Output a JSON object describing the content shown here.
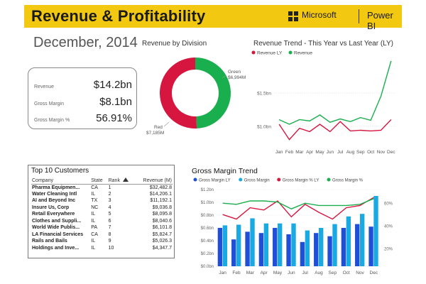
{
  "header": {
    "title": "Revenue & Profitability",
    "brand": "Microsoft",
    "product": "Power BI"
  },
  "date_title": "December, 2014",
  "kpis": [
    {
      "label": "Revenue",
      "value": "$14.2bn"
    },
    {
      "label": "Gross Margin",
      "value": "$8.1bn"
    },
    {
      "label": "Gross Margin %",
      "value": "56.91%"
    }
  ],
  "customers": {
    "title": "Top 10 Customers",
    "columns": {
      "company": "Company",
      "state": "State",
      "rank": "Rank",
      "sort_icon": "sort-ascending-icon",
      "revenue": "Revenue (M)"
    },
    "rows": [
      {
        "company": "Pharma Equipmen...",
        "state": "CA",
        "rank": "1",
        "revenue": "$32,482.8"
      },
      {
        "company": "Water Cleaning Intl",
        "state": "IL",
        "rank": "2",
        "revenue": "$14,206.1"
      },
      {
        "company": "AI and Beyond Inc",
        "state": "TX",
        "rank": "3",
        "revenue": "$11,192.1"
      },
      {
        "company": "Insure Us, Corp",
        "state": "NC",
        "rank": "4",
        "revenue": "$9,036.8"
      },
      {
        "company": "Retail Everywhere",
        "state": "IL",
        "rank": "5",
        "revenue": "$8,095.8"
      },
      {
        "company": "Clothes and Suppli...",
        "state": "IL",
        "rank": "6",
        "revenue": "$8,040.6"
      },
      {
        "company": "World Wide Publis...",
        "state": "PA",
        "rank": "7",
        "revenue": "$6,101.8"
      },
      {
        "company": "LA Financial Services",
        "state": "CA",
        "rank": "8",
        "revenue": "$5,824.7"
      },
      {
        "company": "Rails and Bails",
        "state": "IL",
        "rank": "9",
        "revenue": "$5,026.3"
      },
      {
        "company": "Holdings and Inve...",
        "state": "IL",
        "rank": "10",
        "revenue": "$4,347.7"
      }
    ]
  },
  "colors": {
    "header_bg": "#F2C811",
    "red": "#D7163F",
    "green": "#1AAF4E",
    "dark_blue": "#1F4FD8",
    "light_blue": "#19A9E3"
  },
  "chart_data": [
    {
      "type": "pie",
      "title": "Revenue by Division",
      "donut": true,
      "slices": [
        {
          "name": "Green",
          "label_value": "$6,994M",
          "value": 6994,
          "color": "#1AAF4E"
        },
        {
          "name": "Red",
          "label_value": "$7,185M",
          "value": 7185,
          "color": "#D7163F"
        }
      ]
    },
    {
      "type": "line",
      "title": "Revenue Trend - This Year vs Last Year (LY)",
      "categories": [
        "Jan",
        "Feb",
        "Mar",
        "Apr",
        "May",
        "Jun",
        "Jul",
        "Aug",
        "Sep",
        "Oct",
        "Nov",
        "Dec"
      ],
      "y_ticks": [
        {
          "value": 1.0,
          "label": "$1.0bn"
        },
        {
          "value": 1.5,
          "label": "$1.5bn"
        }
      ],
      "ylim": [
        0.7,
        2.0
      ],
      "legend": "top-left",
      "series": [
        {
          "name": "Revenue LY",
          "color": "#D7163F",
          "values": [
            1.03,
            0.8,
            0.97,
            0.92,
            1.03,
            0.92,
            1.07,
            0.93,
            0.94,
            0.93,
            0.94,
            1.1
          ]
        },
        {
          "name": "Revenue",
          "color": "#1AAF4E",
          "values": [
            1.1,
            1.03,
            1.1,
            1.08,
            1.17,
            1.06,
            1.11,
            1.07,
            1.13,
            1.09,
            1.45,
            1.98
          ]
        }
      ]
    },
    {
      "type": "bar",
      "title": "Gross Margin Trend",
      "categories": [
        "Jan",
        "Feb",
        "Mar",
        "Apr",
        "May",
        "Jun",
        "Jul",
        "Aug",
        "Sep",
        "Oct",
        "Nov",
        "Dec"
      ],
      "legend": "top-left",
      "left_axis": {
        "ticks": [
          "$0.0bn",
          "$0.2bn",
          "$0.4bn",
          "$0.6bn",
          "$0.8bn",
          "$1.0bn",
          "$1.2bn"
        ],
        "ylim": [
          0,
          1.2
        ]
      },
      "right_axis": {
        "ticks": [
          "20%",
          "40%",
          "60%"
        ],
        "ylim": [
          0.045,
          0.72
        ]
      },
      "series": [
        {
          "name": "Gross Margin LY",
          "kind": "bar",
          "axis": "left",
          "color": "#1F4FD8",
          "values": [
            0.6,
            0.42,
            0.54,
            0.52,
            0.6,
            0.5,
            0.38,
            0.52,
            0.47,
            0.6,
            0.66,
            0.62
          ]
        },
        {
          "name": "Gross Margin",
          "kind": "bar",
          "axis": "left",
          "color": "#19A9E3",
          "values": [
            0.64,
            0.65,
            0.75,
            0.67,
            0.67,
            0.67,
            0.56,
            0.6,
            0.66,
            0.78,
            0.82,
            1.1
          ]
        },
        {
          "name": "Gross Margin % LY",
          "kind": "line",
          "axis": "right",
          "color": "#D7163F",
          "values": [
            0.5,
            0.46,
            0.56,
            0.54,
            0.62,
            0.48,
            0.59,
            0.52,
            0.46,
            0.56,
            0.58,
            0.65
          ]
        },
        {
          "name": "Gross Margin %",
          "kind": "line",
          "axis": "right",
          "color": "#1AAF4E",
          "values": [
            0.6,
            0.59,
            0.62,
            0.62,
            0.61,
            0.55,
            0.6,
            0.58,
            0.58,
            0.58,
            0.59,
            0.64
          ]
        }
      ]
    }
  ]
}
